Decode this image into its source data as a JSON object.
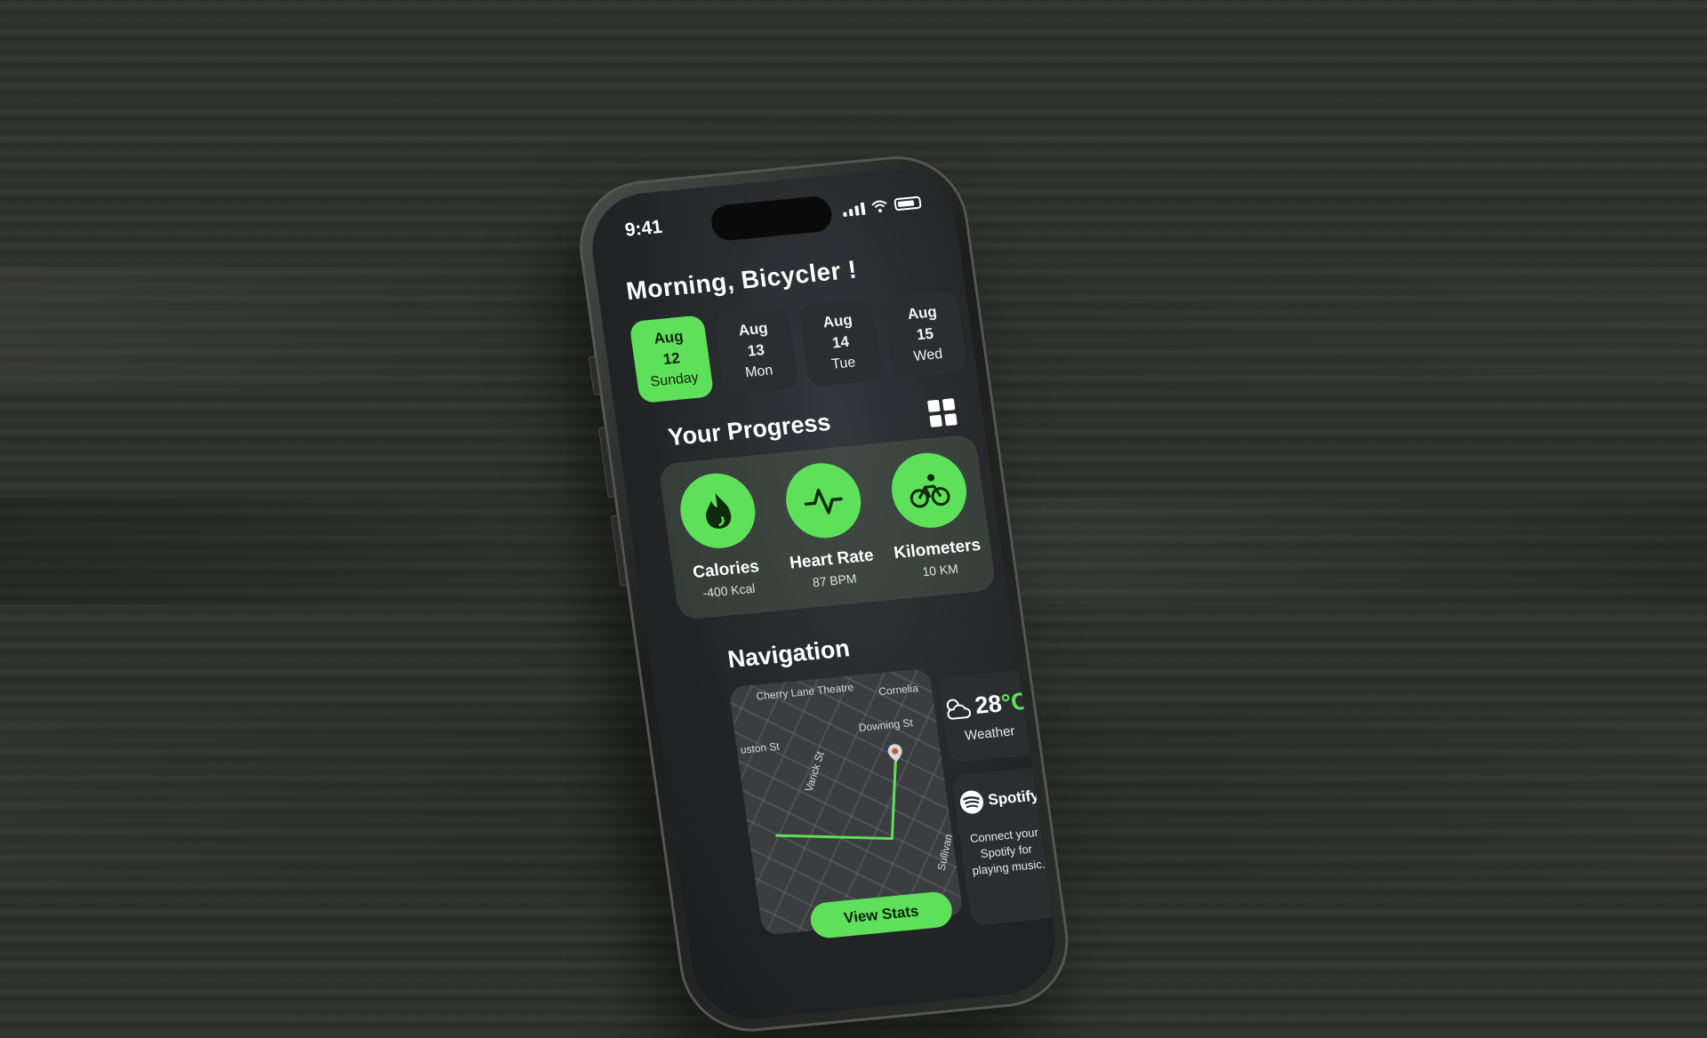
{
  "status_bar": {
    "time": "9:41"
  },
  "greeting": "Morning, Bicycler !",
  "dates": [
    {
      "month": "Aug",
      "day": "12",
      "weekday": "Sunday",
      "selected": true
    },
    {
      "month": "Aug",
      "day": "13",
      "weekday": "Mon",
      "selected": false
    },
    {
      "month": "Aug",
      "day": "14",
      "weekday": "Tue",
      "selected": false
    },
    {
      "month": "Aug",
      "day": "15",
      "weekday": "Wed",
      "selected": false
    }
  ],
  "progress": {
    "title": "Your Progress",
    "stats": [
      {
        "label": "Calories",
        "value": "-400 Kcal",
        "icon": "flame-icon"
      },
      {
        "label": "Heart Rate",
        "value": "87 BPM",
        "icon": "heartbeat-icon"
      },
      {
        "label": "Kilometers",
        "value": "10 KM",
        "icon": "bicycle-icon"
      }
    ]
  },
  "navigation": {
    "title": "Navigation",
    "map_labels": [
      "Cherry Lane Theatre",
      "Cornelia",
      "uston St",
      "Varick St",
      "Downing St",
      "Sullivan"
    ],
    "button_label": "View Stats"
  },
  "weather": {
    "temp": "28",
    "unit": "°C",
    "label": "Weather"
  },
  "spotify": {
    "brand": "Spotify",
    "text": "Connect your Spotify for playing music."
  },
  "colors": {
    "accent": "#5fe05a",
    "card": "#2b2d31",
    "screen": "#222427"
  }
}
